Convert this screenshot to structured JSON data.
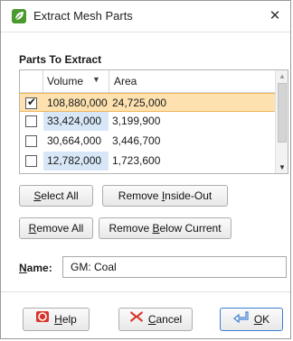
{
  "window": {
    "title": "Extract Mesh Parts",
    "close_glyph": "✕",
    "icon": "app-leaf-icon"
  },
  "parts": {
    "section_title": "Parts To Extract",
    "columns": {
      "volume": "Volume",
      "area": "Area",
      "sort_glyph": "▼"
    },
    "rows": [
      {
        "checked": true,
        "volume": "108,880,000",
        "area": "24,725,000",
        "selected": true
      },
      {
        "checked": false,
        "volume": "33,424,000",
        "area": "3,199,900",
        "selected": false
      },
      {
        "checked": false,
        "volume": "30,664,000",
        "area": "3,446,700",
        "selected": false
      },
      {
        "checked": false,
        "volume": "12,782,000",
        "area": "1,723,600",
        "selected": false
      }
    ]
  },
  "actions": {
    "select_all": {
      "pre": "",
      "ul": "S",
      "post": "elect All"
    },
    "remove_inside_out": {
      "pre": "Remove ",
      "ul": "I",
      "post": "nside-Out"
    },
    "remove_all": {
      "pre": "",
      "ul": "R",
      "post": "emove All"
    },
    "remove_below_current": {
      "pre": "Remove ",
      "ul": "B",
      "post": "elow Current"
    }
  },
  "name_field": {
    "label_ul": "N",
    "label_rest": "ame:",
    "value": "GM: Coal"
  },
  "footer": {
    "help": {
      "ul": "H",
      "post": "elp",
      "icon": "help-lifebuoy-icon",
      "color": "#d9342b"
    },
    "cancel": {
      "ul": "C",
      "post": "ancel",
      "icon": "cancel-x-icon",
      "color": "#d9342b"
    },
    "ok": {
      "ul": "O",
      "post": "K",
      "icon": "ok-return-arrow-icon",
      "color": "#3a7fd1"
    }
  },
  "colors": {
    "selected_row": "#fde2b0",
    "volume_shade": "#d8e7f7",
    "accent": "#4a9a2e"
  }
}
